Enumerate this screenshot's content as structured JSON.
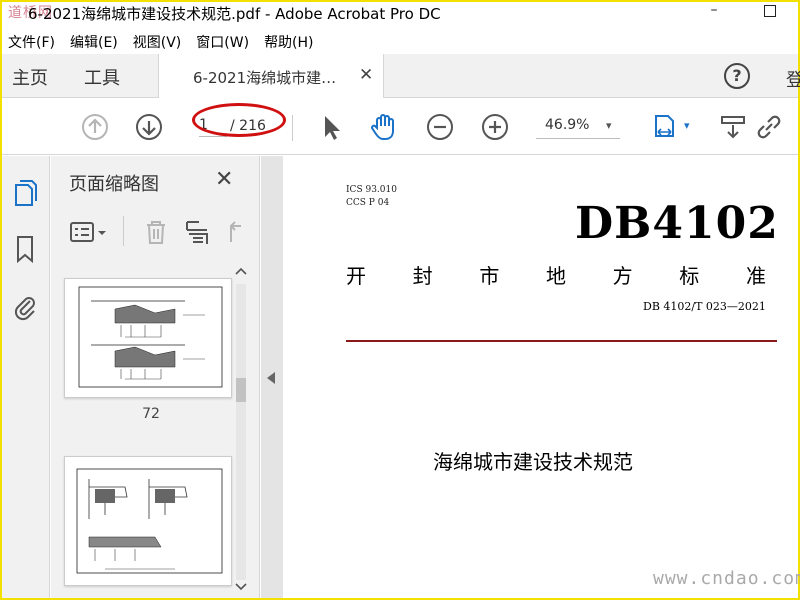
{
  "window": {
    "title": "6-2021海绵城市建设技术规范.pdf - Adobe Acrobat Pro DC",
    "watermark_logo": "道桥网",
    "minimize_glyph": "–"
  },
  "menu": [
    "文件(F)",
    "编辑(E)",
    "视图(V)",
    "窗口(W)",
    "帮助(H)"
  ],
  "tabs": {
    "home": "主页",
    "tools": "工具",
    "document": "6-2021海绵城市建…",
    "close_glyph": "✕",
    "help_glyph": "?",
    "login": "登"
  },
  "toolbar": {
    "page_current": "1",
    "page_total": "/ 216",
    "zoom": "46.9%",
    "dropdown_glyph": "▾",
    "highlight_color": "#d01010",
    "icons": [
      "previous-page-icon",
      "next-page-icon",
      "select-arrow-icon",
      "hand-tool-icon",
      "zoom-out-icon",
      "zoom-in-icon",
      "page-fit-icon",
      "scroll-mode-icon",
      "link-icon"
    ]
  },
  "left_rail": {
    "icons": [
      "page-thumbnails-icon",
      "bookmarks-icon",
      "attachments-icon"
    ],
    "accent_color": "#1a73c9"
  },
  "thumbnail_panel": {
    "title": "页面缩略图",
    "close_glyph": "✕",
    "pages": [
      {
        "label": "72"
      },
      {
        "label": ""
      }
    ]
  },
  "document": {
    "ics_line": "ICS  93.010",
    "ccs_line": "CCS  P  04",
    "code": "DB4102",
    "type_chars": [
      "开",
      "封",
      "市",
      "地",
      "方",
      "标",
      "准"
    ],
    "standard_number": "DB 4102/T  023—2021",
    "title": "海绵城市建设技术规范",
    "rule_color": "#8a1a1a"
  },
  "watermark": {
    "site": "www.cndao.com"
  }
}
